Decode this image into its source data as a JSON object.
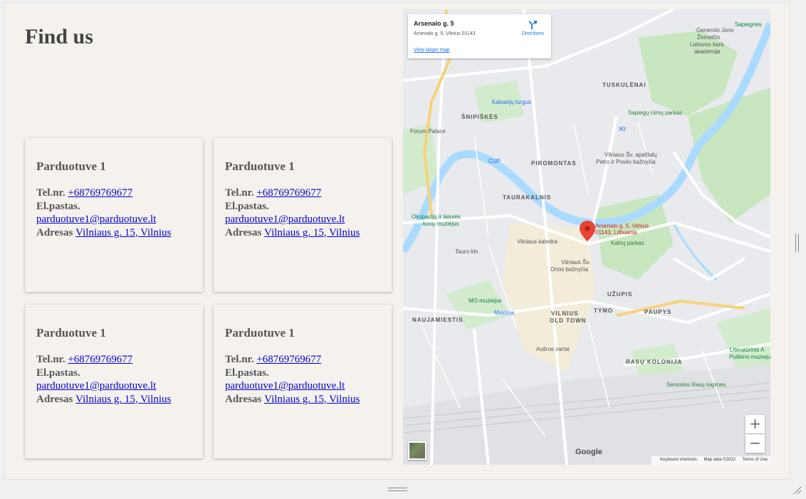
{
  "page": {
    "title": "Find us"
  },
  "cards": [
    {
      "name": "Parduotuve 1",
      "tel_label": "Tel.nr.",
      "tel": "+68769769677",
      "email_label": "El.pastas.",
      "email": "parduotuve1@parduotuve.lt",
      "addr_label": "Adresas",
      "addr": "Vilniaus g. 15, Vilnius"
    },
    {
      "name": "Parduotuve 1",
      "tel_label": "Tel.nr.",
      "tel": "+68769769677",
      "email_label": "El.pastas.",
      "email": "parduotuve1@parduotuve.lt",
      "addr_label": "Adresas",
      "addr": "Vilniaus g. 15, Vilnius"
    },
    {
      "name": "Parduotuve 1",
      "tel_label": "Tel.nr.",
      "tel": "+68769769677",
      "email_label": "El.pastas.",
      "email": "parduotuve1@parduotuve.lt",
      "addr_label": "Adresas",
      "addr": "Vilniaus g. 15, Vilnius"
    },
    {
      "name": "Parduotuve 1",
      "tel_label": "Tel.nr.",
      "tel": "+68769769677",
      "email_label": "El.pastas.",
      "email": "parduotuve1@parduotuve.lt",
      "addr_label": "Adresas",
      "addr": "Vilniaus g. 15, Vilnius"
    }
  ],
  "map": {
    "place_title": "Arsenalo g. 5",
    "place_address": "Arsenalo g. 5, Vilnius 01143",
    "directions": "Directions",
    "view_larger": "View larger map",
    "marker_label_1": "Arsenalo g. 5, Vilnius",
    "marker_label_2": "01143, Lithuania",
    "zoom_in": "+",
    "zoom_out": "−",
    "logo": "Google",
    "footer": {
      "shortcuts": "Keyboard shortcuts",
      "mapdata": "Map data ©2022",
      "terms": "Terms of Use"
    },
    "districts": [
      "TUSKULĖNAI",
      "ŠNIPIŠKĖS",
      "PIROMONTAS",
      "TAURAKALNIS",
      "NAUJAMIESTIS",
      "VILNIUS",
      "OLD TOWN",
      "UŽUPIS",
      "TYMO",
      "PAUPYS",
      "RASŲ KOLONIJA"
    ],
    "pois": [
      "Kalvarijų turgus",
      "Sapiegų rūmų parkas",
      "Forum Palace",
      "CUP",
      "Vilniaus Šv. apaštalų",
      "Petro ir Povilo bažnyčia",
      "Okupacijų ir laisvės",
      "kovų muziejus",
      "Vilniaus katedra",
      "Kalnų parkas",
      "Tauro kln",
      "Vilniaus Šv.",
      "Onos bažnyčia",
      "MO muziejus",
      "Maxima",
      "Aušros vartai",
      "Senosios Rasų kapinės",
      "Literatūrinis A",
      "Puškino muziejus",
      "Sapiegnės",
      "Generolo Jono",
      "Žemaičio",
      "Lietuvos karo",
      "akademija",
      "IKI"
    ],
    "colors": {
      "water": "#aadaff",
      "park": "#c8e6c0",
      "road": "#ffffff",
      "marker": "#ea4335",
      "link": "#1a73e8"
    }
  }
}
